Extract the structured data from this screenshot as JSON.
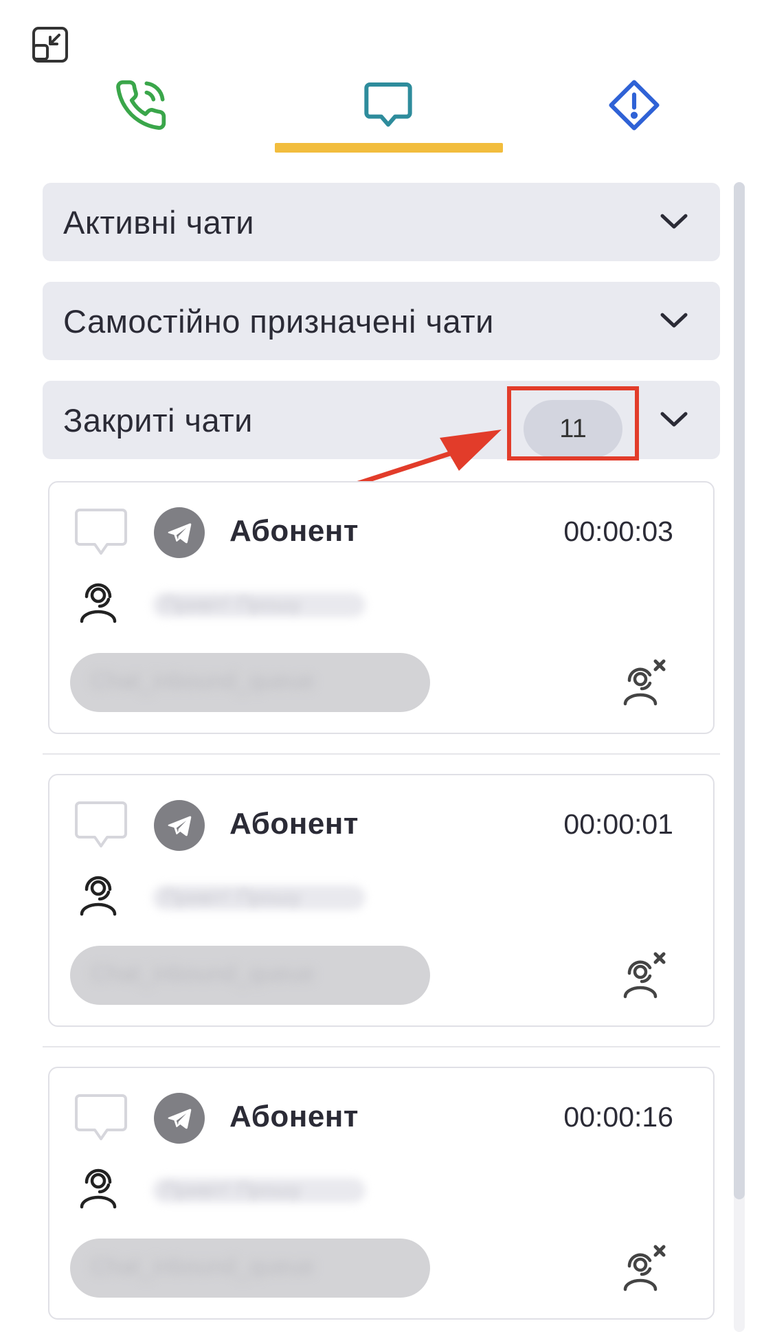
{
  "tabs": [
    {
      "id": "calls",
      "icon": "phone-icon",
      "color": "#3aa64a"
    },
    {
      "id": "chats",
      "icon": "chat-bubble-icon",
      "color": "#2e8c9c",
      "active": true
    },
    {
      "id": "alerts",
      "icon": "alert-diamond-icon",
      "color": "#2f62d6"
    }
  ],
  "accent_underline": "#f2bd3d",
  "sections": {
    "active": {
      "title": "Активні чати"
    },
    "self_assigned": {
      "title": "Самостійно призначені чати"
    },
    "closed": {
      "title": "Закриті чати",
      "count": "11"
    }
  },
  "annotation": {
    "highlight_color": "#e23c2a"
  },
  "chats": [
    {
      "name": "Абонент",
      "time": "00:00:03",
      "preview": "Привіт! Прошу",
      "queue": "Chat_inbound_queue"
    },
    {
      "name": "Абонент",
      "time": "00:00:01",
      "preview": "Привіт! Прошу",
      "queue": "Chat_inbound_queue"
    },
    {
      "name": "Абонент",
      "time": "00:00:16",
      "preview": "Привіт! Прошу",
      "queue": "Chat_inbound_queue"
    }
  ]
}
